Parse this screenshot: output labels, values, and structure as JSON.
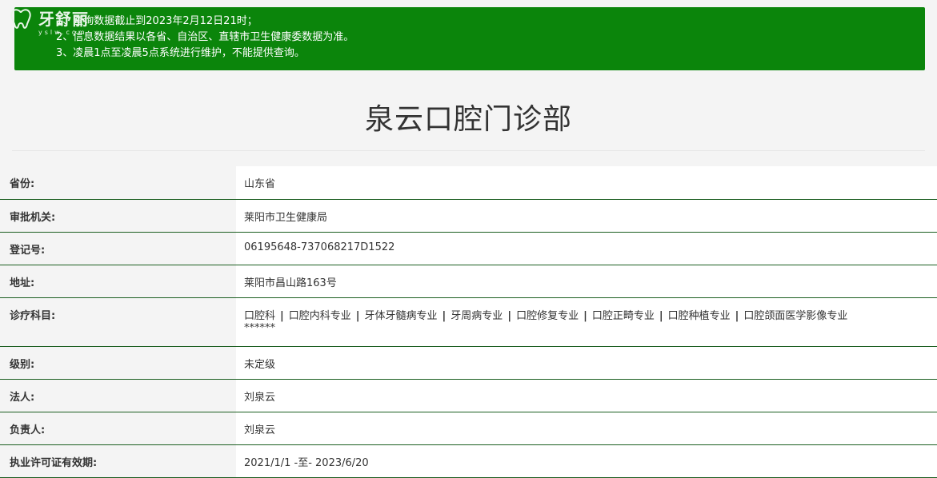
{
  "logo": {
    "text": "牙舒丽",
    "sub": "yslw.com"
  },
  "notice": {
    "lines": [
      "1、查询数据截止到2023年2月12日21时；",
      "2、信息数据结果以各省、自治区、直辖市卫生健康委数据为准。",
      "3、凌晨1点至凌晨5点系统进行维护，不能提供查询。"
    ]
  },
  "title": "泉云口腔门诊部",
  "rows": [
    {
      "label": "省份:",
      "value": "山东省"
    },
    {
      "label": "审批机关:",
      "value": "莱阳市卫生健康局"
    },
    {
      "label": "登记号:",
      "value": "06195648-737068217D1522"
    },
    {
      "label": "地址:",
      "value": "莱阳市昌山路163号"
    },
    {
      "label": "诊疗科目:",
      "specialties": [
        "口腔科",
        "口腔内科专业",
        "牙体牙髓病专业",
        "牙周病专业",
        "口腔修复专业",
        "口腔正畸专业",
        "口腔种植专业",
        "口腔颌面医学影像专业"
      ],
      "tail": "******",
      "separator": "|"
    },
    {
      "label": "级别:",
      "value": "未定级"
    },
    {
      "label": "法人:",
      "value": "刘泉云"
    },
    {
      "label": "负责人:",
      "value": "刘泉云"
    },
    {
      "label": "执业许可证有效期:",
      "value": "2021/1/1 -至- 2023/6/20"
    }
  ]
}
